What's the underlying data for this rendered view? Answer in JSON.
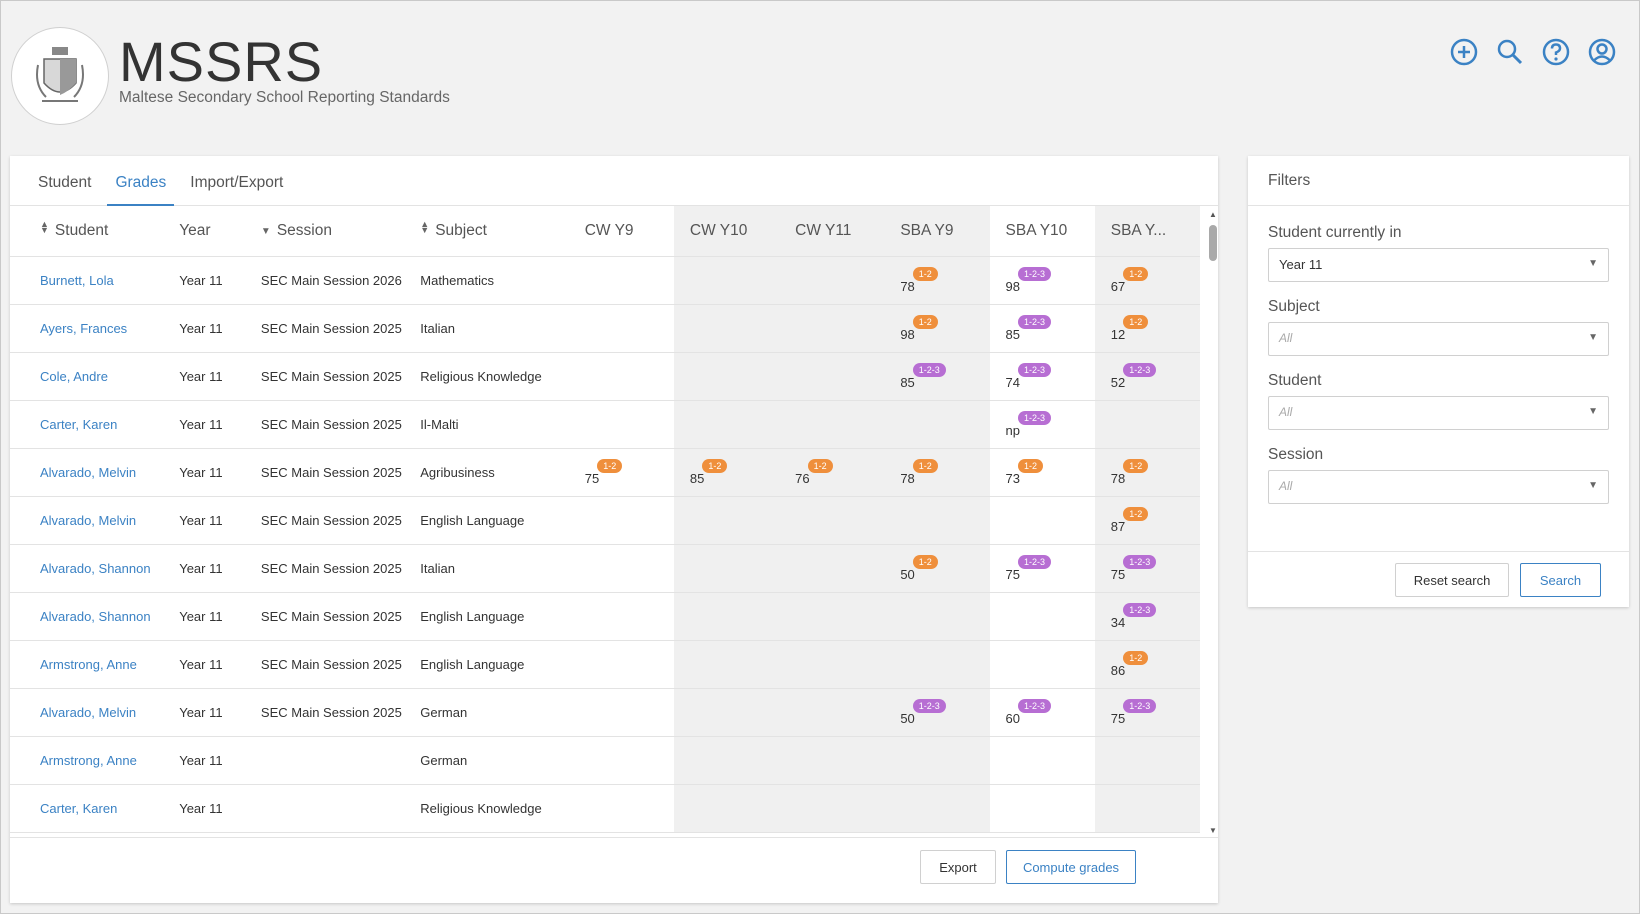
{
  "header": {
    "title": "MSSRS",
    "subtitle": "Maltese Secondary School Reporting Standards",
    "icons": [
      "add-circle-icon",
      "search-icon",
      "help-icon",
      "account-icon"
    ],
    "accent": "#3b82c4"
  },
  "tabs": [
    {
      "label": "Student",
      "active": false
    },
    {
      "label": "Grades",
      "active": true
    },
    {
      "label": "Import/Export",
      "active": false
    }
  ],
  "table": {
    "columns": {
      "student": "Student",
      "year": "Year",
      "session": "Session",
      "subject": "Subject",
      "cw_y9": "CW Y9",
      "cw_y10": "CW Y10",
      "cw_y11": "CW Y11",
      "sba_y9": "SBA Y9",
      "sba_y10": "SBA Y10",
      "sba_y11": "SBA Y..."
    },
    "rows": [
      {
        "student": "Burnett, Lola",
        "year": "Year 11",
        "session": "SEC Main Session 2026",
        "subject": "Mathematics",
        "cw_y9": "",
        "cw_y9_b": "",
        "cw_y10": "",
        "cw_y10_b": "",
        "cw_y11": "",
        "cw_y11_b": "",
        "sba_y9": "78",
        "sba_y9_b": "1-2",
        "sba_y10": "98",
        "sba_y10_b": "1-2-3",
        "sba_y11": "67",
        "sba_y11_b": "1-2"
      },
      {
        "student": "Ayers, Frances",
        "year": "Year 11",
        "session": "SEC Main Session 2025",
        "subject": "Italian",
        "cw_y9": "",
        "cw_y9_b": "",
        "cw_y10": "",
        "cw_y10_b": "",
        "cw_y11": "",
        "cw_y11_b": "",
        "sba_y9": "98",
        "sba_y9_b": "1-2",
        "sba_y10": "85",
        "sba_y10_b": "1-2-3",
        "sba_y11": "12",
        "sba_y11_b": "1-2"
      },
      {
        "student": "Cole, Andre",
        "year": "Year 11",
        "session": "SEC Main Session 2025",
        "subject": "Religious Knowledge",
        "cw_y9": "",
        "cw_y9_b": "",
        "cw_y10": "",
        "cw_y10_b": "",
        "cw_y11": "",
        "cw_y11_b": "",
        "sba_y9": "85",
        "sba_y9_b": "1-2-3",
        "sba_y10": "74",
        "sba_y10_b": "1-2-3",
        "sba_y11": "52",
        "sba_y11_b": "1-2-3"
      },
      {
        "student": "Carter, Karen",
        "year": "Year 11",
        "session": "SEC Main Session 2025",
        "subject": "Il-Malti",
        "cw_y9": "",
        "cw_y9_b": "",
        "cw_y10": "",
        "cw_y10_b": "",
        "cw_y11": "",
        "cw_y11_b": "",
        "sba_y9": "",
        "sba_y9_b": "",
        "sba_y10": "np",
        "sba_y10_b": "1-2-3",
        "sba_y11": "",
        "sba_y11_b": ""
      },
      {
        "student": "Alvarado, Melvin",
        "year": "Year 11",
        "session": "SEC Main Session 2025",
        "subject": "Agribusiness",
        "cw_y9": "75",
        "cw_y9_b": "1-2",
        "cw_y10": "85",
        "cw_y10_b": "1-2",
        "cw_y11": "76",
        "cw_y11_b": "1-2",
        "sba_y9": "78",
        "sba_y9_b": "1-2",
        "sba_y10": "73",
        "sba_y10_b": "1-2",
        "sba_y11": "78",
        "sba_y11_b": "1-2"
      },
      {
        "student": "Alvarado, Melvin",
        "year": "Year 11",
        "session": "SEC Main Session 2025",
        "subject": "English Language",
        "cw_y9": "",
        "cw_y9_b": "",
        "cw_y10": "",
        "cw_y10_b": "",
        "cw_y11": "",
        "cw_y11_b": "",
        "sba_y9": "",
        "sba_y9_b": "",
        "sba_y10": "",
        "sba_y10_b": "",
        "sba_y11": "87",
        "sba_y11_b": "1-2"
      },
      {
        "student": "Alvarado, Shannon",
        "year": "Year 11",
        "session": "SEC Main Session 2025",
        "subject": "Italian",
        "cw_y9": "",
        "cw_y9_b": "",
        "cw_y10": "",
        "cw_y10_b": "",
        "cw_y11": "",
        "cw_y11_b": "",
        "sba_y9": "50",
        "sba_y9_b": "1-2",
        "sba_y10": "75",
        "sba_y10_b": "1-2-3",
        "sba_y11": "75",
        "sba_y11_b": "1-2-3"
      },
      {
        "student": "Alvarado, Shannon",
        "year": "Year 11",
        "session": "SEC Main Session 2025",
        "subject": "English Language",
        "cw_y9": "",
        "cw_y9_b": "",
        "cw_y10": "",
        "cw_y10_b": "",
        "cw_y11": "",
        "cw_y11_b": "",
        "sba_y9": "",
        "sba_y9_b": "",
        "sba_y10": "",
        "sba_y10_b": "",
        "sba_y11": "34",
        "sba_y11_b": "1-2-3"
      },
      {
        "student": "Armstrong, Anne",
        "year": "Year 11",
        "session": "SEC Main Session 2025",
        "subject": "English Language",
        "cw_y9": "",
        "cw_y9_b": "",
        "cw_y10": "",
        "cw_y10_b": "",
        "cw_y11": "",
        "cw_y11_b": "",
        "sba_y9": "",
        "sba_y9_b": "",
        "sba_y10": "",
        "sba_y10_b": "",
        "sba_y11": "86",
        "sba_y11_b": "1-2"
      },
      {
        "student": "Alvarado, Melvin",
        "year": "Year 11",
        "session": "SEC Main Session 2025",
        "subject": "German",
        "cw_y9": "",
        "cw_y9_b": "",
        "cw_y10": "",
        "cw_y10_b": "",
        "cw_y11": "",
        "cw_y11_b": "",
        "sba_y9": "50",
        "sba_y9_b": "1-2-3",
        "sba_y10": "60",
        "sba_y10_b": "1-2-3",
        "sba_y11": "75",
        "sba_y11_b": "1-2-3"
      },
      {
        "student": "Armstrong, Anne",
        "year": "Year 11",
        "session": "",
        "subject": "German",
        "cw_y9": "",
        "cw_y9_b": "",
        "cw_y10": "",
        "cw_y10_b": "",
        "cw_y11": "",
        "cw_y11_b": "",
        "sba_y9": "",
        "sba_y9_b": "",
        "sba_y10": "",
        "sba_y10_b": "",
        "sba_y11": "",
        "sba_y11_b": ""
      },
      {
        "student": "Carter, Karen",
        "year": "Year 11",
        "session": "",
        "subject": "Religious Knowledge",
        "cw_y9": "",
        "cw_y9_b": "",
        "cw_y10": "",
        "cw_y10_b": "",
        "cw_y11": "",
        "cw_y11_b": "",
        "sba_y9": "",
        "sba_y9_b": "",
        "sba_y10": "",
        "sba_y10_b": "",
        "sba_y11": "",
        "sba_y11_b": ""
      }
    ],
    "badge_colors": {
      "1-2": "#ef8f3c",
      "1-2-3": "#b76ed3"
    }
  },
  "footer": {
    "export_label": "Export",
    "compute_label": "Compute grades"
  },
  "filters": {
    "title": "Filters",
    "student_currently_in": {
      "label": "Student currently in",
      "value": "Year 11"
    },
    "subject": {
      "label": "Subject",
      "placeholder": "All"
    },
    "student": {
      "label": "Student",
      "placeholder": "All"
    },
    "session": {
      "label": "Session",
      "placeholder": "All"
    },
    "reset_label": "Reset search",
    "search_label": "Search"
  }
}
